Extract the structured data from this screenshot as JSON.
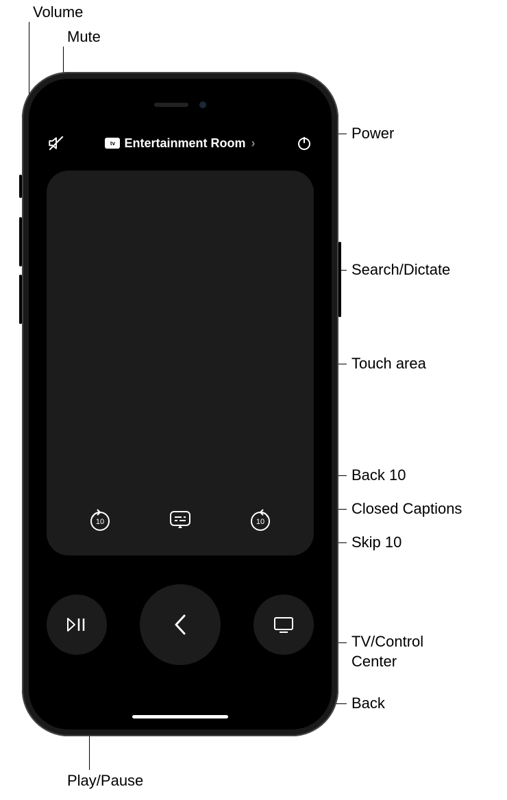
{
  "callouts": {
    "volume": "Volume",
    "mute": "Mute",
    "power": "Power",
    "search_dictate": "Search/Dictate",
    "touch_area": "Touch area",
    "back_10": "Back 10",
    "closed_captions": "Closed Captions",
    "skip_10": "Skip 10",
    "tv_control_center": "TV/Control\nCenter",
    "back": "Back",
    "play_pause": "Play/Pause"
  },
  "topbar": {
    "device_badge_text": "tv",
    "device_name": "Entertainment Room"
  },
  "icons": {
    "mute": "mute-icon",
    "power": "power-icon",
    "back10": "back-10-icon",
    "captions": "closed-captions-icon",
    "skip10": "skip-10-icon",
    "playpause": "play-pause-icon",
    "back": "back-chevron-icon",
    "tv": "tv-icon"
  }
}
